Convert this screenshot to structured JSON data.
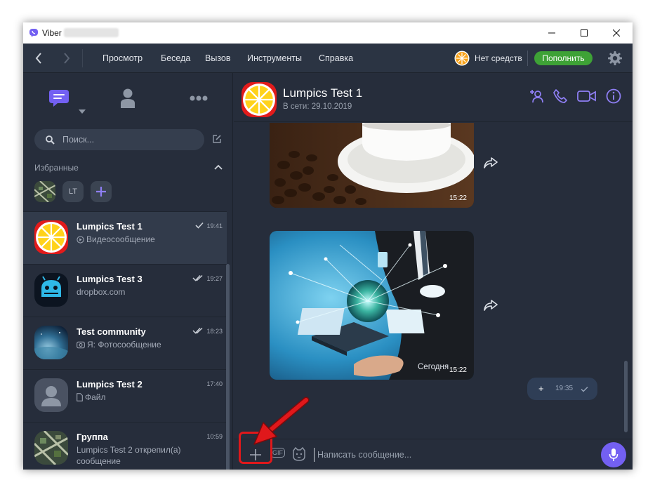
{
  "window": {
    "app_name": "Viber"
  },
  "toolbar": {
    "menu": [
      "Просмотр",
      "Беседа",
      "Вызов",
      "Инструменты",
      "Справка"
    ],
    "balance": "Нет средств",
    "topup_label": "Пополнить"
  },
  "sidebar": {
    "search_placeholder": "Поиск...",
    "favorites_title": "Избранные",
    "favorites": [
      {
        "type": "photo",
        "icon": "group-photo-icon"
      },
      {
        "initials": "LT"
      },
      {
        "type": "add",
        "icon": "plus-icon"
      }
    ],
    "chats": [
      {
        "name": "Lumpics Test 1",
        "preview": "Видеосообщение",
        "time": "19:41",
        "status": "sent",
        "avatar": "lemon"
      },
      {
        "name": "Lumpics Test 3",
        "preview": "dropbox.com",
        "time": "19:27",
        "status": "read",
        "avatar": "android"
      },
      {
        "name": "Test community",
        "preview": "Я: Фотосообщение",
        "time": "18:23",
        "status": "read",
        "avatar": "planet"
      },
      {
        "name": "Lumpics Test 2",
        "preview": "Файл",
        "time": "17:40",
        "status": "none",
        "avatar": "default"
      },
      {
        "name": "Группа",
        "preview": "Lumpics Test 2 открепил(а) сообщение",
        "time": "10:59",
        "status": "none",
        "avatar": "city"
      }
    ]
  },
  "conversation": {
    "contact_name": "Lumpics Test 1",
    "contact_status": "В сети: 29.10.2019",
    "messages": [
      {
        "type": "image",
        "subject": "coffee",
        "time": "15:22"
      },
      {
        "type": "image",
        "subject": "technology",
        "time": "15:22"
      }
    ],
    "day_separator": "Сегодня",
    "outgoing": {
      "text": "+",
      "time": "19:35",
      "status": "sent"
    },
    "composer_placeholder": "Написать сообщение...",
    "gif_label": "GIF"
  },
  "colors": {
    "accent": "#7360f2",
    "topup": "#3ea236",
    "background": "#262d3b",
    "annotation": "#e0181b"
  }
}
